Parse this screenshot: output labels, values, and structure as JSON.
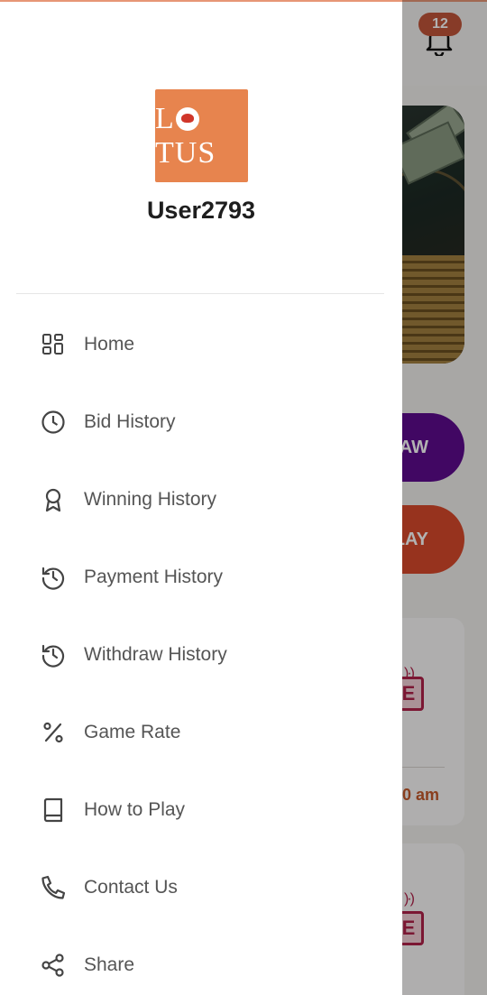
{
  "background": {
    "notification_count": "12",
    "withdraw_button_text": "AW",
    "play_button_text": "LAY",
    "live_badge_text": "E",
    "card_time_text": "0 am"
  },
  "drawer": {
    "logo_text_before": "L",
    "logo_text_after": "TUS",
    "username": "User2793",
    "menu": [
      {
        "label": "Home",
        "icon": "grid-icon"
      },
      {
        "label": "Bid History",
        "icon": "clock-icon"
      },
      {
        "label": "Winning History",
        "icon": "award-icon"
      },
      {
        "label": "Payment History",
        "icon": "history-icon"
      },
      {
        "label": "Withdraw History",
        "icon": "history-icon"
      },
      {
        "label": "Game Rate",
        "icon": "percent-icon"
      },
      {
        "label": "How to Play",
        "icon": "book-icon"
      },
      {
        "label": "Contact Us",
        "icon": "phone-icon"
      },
      {
        "label": "Share",
        "icon": "share-icon"
      }
    ]
  },
  "colors": {
    "brand": "#e7844e",
    "withdraw": "#5d0b8f",
    "play": "#d9492c"
  }
}
